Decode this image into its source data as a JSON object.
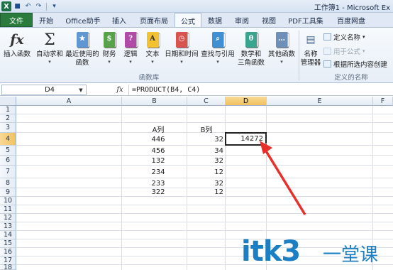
{
  "window": {
    "title": "工作簿1 - Microsoft Ex"
  },
  "tabs": [
    {
      "label": "文件"
    },
    {
      "label": "开始"
    },
    {
      "label": "Office助手"
    },
    {
      "label": "插入"
    },
    {
      "label": "页面布局"
    },
    {
      "label": "公式"
    },
    {
      "label": "数据"
    },
    {
      "label": "审阅"
    },
    {
      "label": "视图"
    },
    {
      "label": "PDF工具集"
    },
    {
      "label": "百度网盘"
    }
  ],
  "ribbon": {
    "insert_function": "插入函数",
    "autosum": "自动求和",
    "recent_line1": "最近使用的",
    "recent_line2": "函数",
    "financial": "财务",
    "logical": "逻辑",
    "text": "文本",
    "datetime": "日期和时间",
    "lookup": "查找与引用",
    "math_line1": "数学和",
    "math_line2": "三角函数",
    "other": "其他函数",
    "name_manager_line1": "名称",
    "name_manager_line2": "管理器",
    "define_name": "定义名称",
    "use_in_formula": "用于公式",
    "create_from_selection": "根据所选内容创建",
    "group_function_library": "函数库",
    "group_defined_names": "定义的名称"
  },
  "formula_bar": {
    "name_box": "D4",
    "fx": "fx",
    "formula": "=PRODUCT(B4, C4)"
  },
  "columns": [
    "A",
    "B",
    "C",
    "D",
    "E",
    "F"
  ],
  "rows": [
    "1",
    "2",
    "3",
    "4",
    "5",
    "6",
    "7",
    "8",
    "9",
    "10",
    "11",
    "12",
    "13",
    "14",
    "15",
    "16",
    "17",
    "18"
  ],
  "cells": {
    "b3": "A列",
    "c3": "B列",
    "b4": "446",
    "c4": "32",
    "d4": "14272",
    "b5": "456",
    "c5": "34",
    "b6": "132",
    "c6": "32",
    "b7": "234",
    "c7": "12",
    "b8": "233",
    "c8": "32",
    "b9": "322",
    "c9": "12"
  },
  "watermark": {
    "text": "itk3",
    "cn": "一堂课"
  },
  "colors": {
    "accent": "#2b7b3f",
    "annotation": "#e8302a",
    "watermark": "#1d7fc3"
  }
}
